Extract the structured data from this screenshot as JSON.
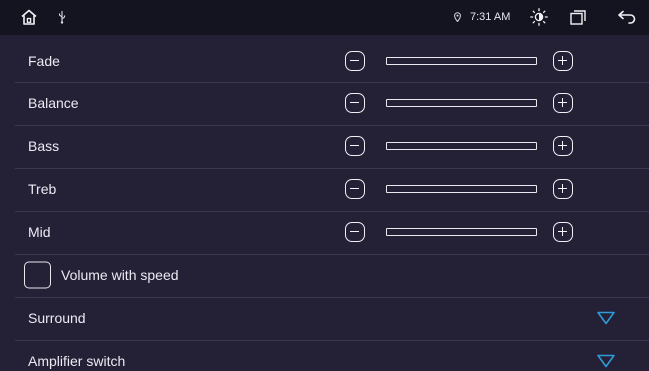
{
  "status_bar": {
    "time": "7:31 AM",
    "icons": [
      "home-icon",
      "usb-icon",
      "location-icon",
      "brightness-icon",
      "recent-apps-icon",
      "back-icon"
    ]
  },
  "colors": {
    "background": "#242036",
    "status_bar": "#141320",
    "divider": "#3a3750",
    "text": "#eceaf2",
    "accent_arrow": "#2e9bd6"
  },
  "sliders": [
    {
      "label": "Fade",
      "value": 0
    },
    {
      "label": "Balance",
      "value": 0
    },
    {
      "label": "Bass",
      "value": 0
    },
    {
      "label": "Treb",
      "value": 0
    },
    {
      "label": "Mid",
      "value": 0
    }
  ],
  "volume_with_speed": {
    "label": "Volume with speed",
    "checked": false
  },
  "dropdowns": [
    {
      "label": "Surround"
    },
    {
      "label": "Amplifier switch"
    }
  ]
}
